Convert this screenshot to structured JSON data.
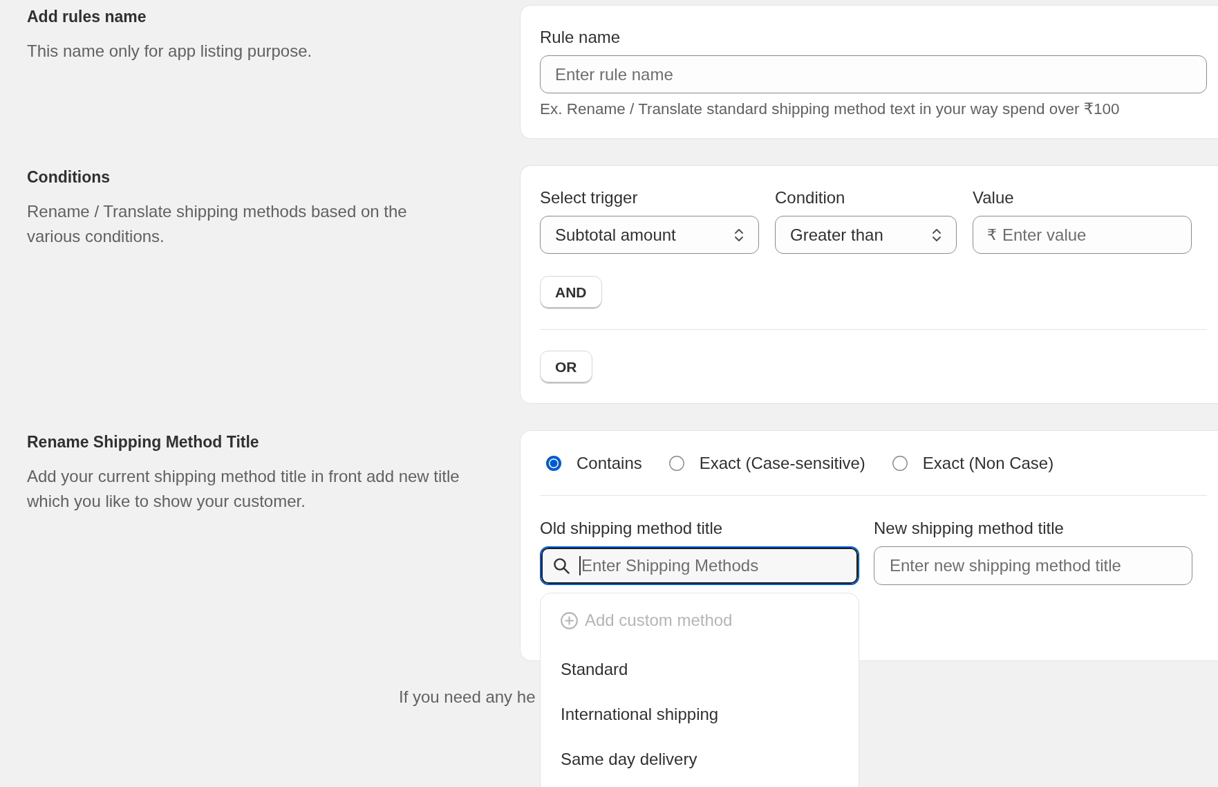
{
  "rule_name_section": {
    "title": "Add rules name",
    "description": "This name only for app listing purpose.",
    "label": "Rule name",
    "placeholder": "Enter rule name",
    "help_text": "Ex. Rename / Translate standard shipping method text in your way spend over ₹100"
  },
  "conditions_section": {
    "title": "Conditions",
    "description": "Rename / Translate shipping methods based on the various conditions.",
    "trigger": {
      "label": "Select trigger",
      "value": "Subtotal amount"
    },
    "condition": {
      "label": "Condition",
      "value": "Greater than"
    },
    "value": {
      "label": "Value",
      "prefix": "₹",
      "placeholder": "Enter value"
    },
    "and_button": "AND",
    "or_button": "OR"
  },
  "rename_section": {
    "title": "Rename Shipping Method Title",
    "description": "Add your current shipping method title in front add new title which you like to show your customer.",
    "match_options": [
      {
        "label": "Contains",
        "selected": true
      },
      {
        "label": "Exact (Case-sensitive)",
        "selected": false
      },
      {
        "label": "Exact (Non Case)",
        "selected": false
      }
    ],
    "old_title": {
      "label": "Old shipping method title",
      "placeholder": "Enter Shipping Methods",
      "focused": true
    },
    "new_title": {
      "label": "New shipping method title",
      "placeholder": "Enter new shipping method title"
    },
    "dropdown": {
      "open": true,
      "add_custom": {
        "label": "Add custom method",
        "disabled": true
      },
      "options": [
        "Standard",
        "International shipping",
        "Same day delivery"
      ]
    }
  },
  "footer_text": "If you need any he"
}
